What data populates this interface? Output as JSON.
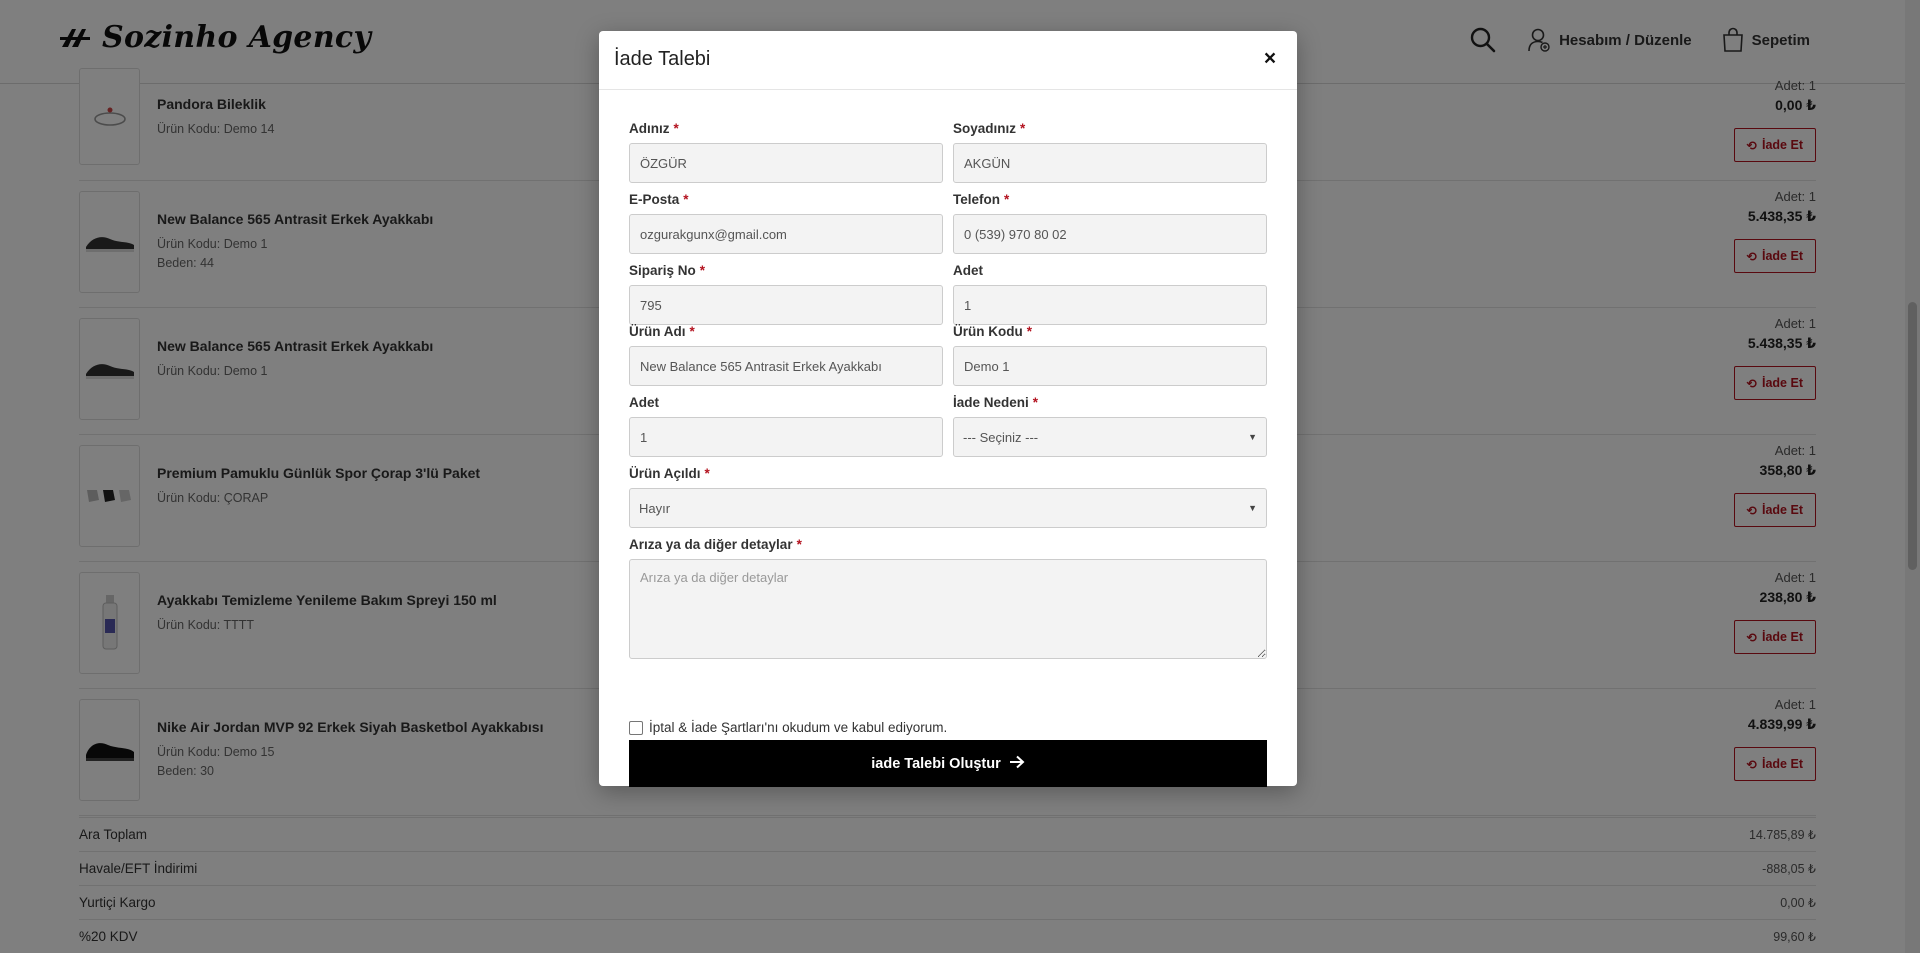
{
  "header": {
    "logo_text": "Sozinho Agency",
    "account_label": "Hesabım / Düzenle",
    "cart_label": "Sepetim"
  },
  "order": {
    "items": [
      {
        "name": "Pandora Bileklik",
        "code": "Ürün Kodu: Demo 14",
        "size": "",
        "qty": "Adet: 1",
        "price": "0,00 ₺",
        "button": "İade Et"
      },
      {
        "name": "New Balance 565 Antrasit Erkek Ayakkabı",
        "code": "Ürün Kodu: Demo 1",
        "size": "Beden: 44",
        "qty": "Adet: 1",
        "price": "5.438,35 ₺",
        "button": "İade Et"
      },
      {
        "name": "New Balance 565 Antrasit Erkek Ayakkabı",
        "code": "Ürün Kodu: Demo 1",
        "size": "",
        "qty": "Adet: 1",
        "price": "5.438,35 ₺",
        "button": "İade Et"
      },
      {
        "name": "Premium Pamuklu Günlük Spor Çorap 3'lü Paket",
        "code": "Ürün Kodu: ÇORAP",
        "size": "",
        "qty": "Adet: 1",
        "price": "358,80 ₺",
        "button": "İade Et"
      },
      {
        "name": "Ayakkabı Temizleme Yenileme Bakım Spreyi 150 ml",
        "code": "Ürün Kodu: TTTT",
        "size": "",
        "qty": "Adet: 1",
        "price": "238,80 ₺",
        "button": "İade Et"
      },
      {
        "name": "Nike Air Jordan MVP 92 Erkek Siyah Basketbol Ayakkabısı",
        "code": "Ürün Kodu: Demo 15",
        "size": "Beden: 30",
        "qty": "Adet: 1",
        "price": "4.839,99 ₺",
        "button": "İade Et"
      }
    ],
    "totals": [
      {
        "label": "Ara Toplam",
        "value": "14.785,89 ₺"
      },
      {
        "label": "Havale/EFT İndirimi",
        "value": "-888,05 ₺"
      },
      {
        "label": "Yurtiçi Kargo",
        "value": "0,00 ₺"
      },
      {
        "label": "%20 KDV",
        "value": "99,60 ₺"
      }
    ]
  },
  "modal": {
    "title": "İade Talebi",
    "close": "×",
    "fields": {
      "first_name": {
        "label": "Adınız",
        "value": "ÖZGÜR"
      },
      "last_name": {
        "label": "Soyadınız",
        "value": "AKGÜN"
      },
      "email": {
        "label": "E-Posta",
        "value": "ozgurakgunx@gmail.com"
      },
      "phone": {
        "label": "Telefon",
        "value": "0 (539) 970 80 02"
      },
      "order_no": {
        "label": "Sipariş No",
        "value": "795"
      },
      "order_qty": {
        "label": "Adet",
        "value": "1"
      },
      "product_name": {
        "label": "Ürün Adı",
        "value": "New Balance 565 Antrasit Erkek Ayakkabı"
      },
      "product_code": {
        "label": "Ürün Kodu",
        "value": "Demo 1"
      },
      "return_qty": {
        "label": "Adet",
        "value": "1"
      },
      "reason": {
        "label": "İade Nedeni",
        "value": "--- Seçiniz ---"
      },
      "opened": {
        "label": "Ürün Açıldı",
        "value": "Hayır"
      },
      "details": {
        "label": "Arıza ya da diğer detaylar",
        "placeholder": "Arıza ya da diğer detaylar"
      }
    },
    "required_mark": "*",
    "terms_label": "İptal & İade Şartları'nı okudum ve kabul ediyorum.",
    "submit_label": "iade Talebi Oluştur"
  },
  "colors": {
    "accent_red": "#b3121f",
    "submit_bg": "#000000"
  }
}
